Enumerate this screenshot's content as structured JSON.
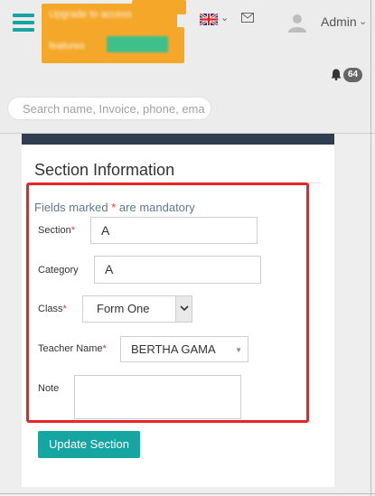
{
  "header": {
    "admin_label": "Admin",
    "notifications_count": "64",
    "search_placeholder": "Search name, Invoice, phone, ema",
    "promo_text_1": "Upgrade to access",
    "promo_text_2": "features",
    "brand_color": "#16a5a1"
  },
  "form": {
    "title": "Section Information",
    "mandatory_prefix": "Fields marked ",
    "mandatory_star": "*",
    "mandatory_suffix": " are mandatory",
    "section_label": "Section",
    "section_value": "A",
    "category_label": "Category",
    "category_value": "A",
    "class_label": "Class",
    "class_value": "Form One",
    "teacher_label": "Teacher Name",
    "teacher_value": "BERTHA GAMA",
    "note_label": "Note",
    "note_value": "",
    "required_mark": "*",
    "submit_label": "Update Section",
    "highlight_color": "#e8232a"
  }
}
